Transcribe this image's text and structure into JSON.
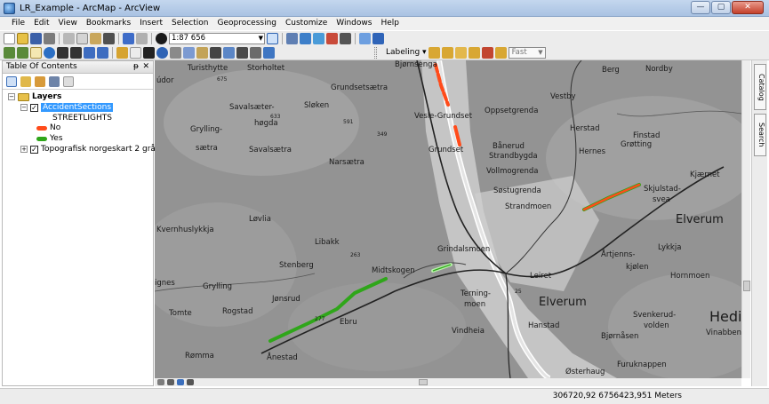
{
  "window": {
    "title": "LR_Example - ArcMap - ArcView",
    "min": "—",
    "max": "▢",
    "close": "✕"
  },
  "menu": [
    "File",
    "Edit",
    "View",
    "Bookmarks",
    "Insert",
    "Selection",
    "Geoprocessing",
    "Customize",
    "Windows",
    "Help"
  ],
  "toolbar": {
    "scale": "1:87 656",
    "labeling": "Labeling ▾",
    "quality": "Fast"
  },
  "toc": {
    "title": "Table Of Contents",
    "pin": "ᵽ",
    "close": "✕",
    "root": "Layers",
    "layer1": "AccidentSections",
    "field": "STREETLIGHTS",
    "legend": [
      {
        "label": "No",
        "color": "#ff4b1a"
      },
      {
        "label": "Yes",
        "color": "#2fa61a"
      }
    ],
    "layer2": "Topografisk norgeskart 2 gråtone",
    "expanded": "−",
    "collapsed": "+",
    "check": "✓"
  },
  "map": {
    "labels": {
      "turisthytte": "Turisthytte",
      "storholtet": "Storholtet",
      "udor": "údor",
      "bjornsenga": "Bjørnsenga",
      "berg": "Berg",
      "nordby": "Nordby",
      "grundsetsaetra": "Grundsetsætra",
      "vestby": "Vestby",
      "savalsaeter": "Savalsæter-",
      "hogda": "høgda",
      "sloken": "Sløken",
      "vesle_grundset": "Vesle-Grundset",
      "oppsetgrenda": "Oppsetgrenda",
      "herstad": "Herstad",
      "finstad": "Finstad",
      "grotting": "Grøtting",
      "grylling1": "Grylling-",
      "saetra": "sætra",
      "savalsaetra": "Savalsætra",
      "narsaetra": "Narsætra",
      "banerud": "Bånerud",
      "strandbygda": "Strandbygda",
      "hernes": "Hernes",
      "grundset": "Grundset",
      "vollmogrenda": "Vollmogrenda",
      "kjaernet": "Kjærnet",
      "skjulstad": "Skjulstad-",
      "svea": "svea",
      "sostugrenda": "Søstugrenda",
      "strandmoen": "Strandmoen",
      "elverum_big": "Elverum",
      "lovlia": "Løvlia",
      "kvernhuslykkja": "Kvernhuslykkja",
      "libakk": "Libakk",
      "lykkja": "Lykkja",
      "grindalsmoen": "Grindalsmoen",
      "artjenns": " Årtjenns-",
      "kjolen": "kjølen",
      "stenberg": "Stenberg",
      "midtskogen": "Midtskogen",
      "leiret": "Leiret",
      "hornmoen": "Hornmoen",
      "ignes": "ignes",
      "grylling2": "Grylling",
      "jonsrud": "Jønsrud",
      "terningmoen1": "Terning-",
      "terningmoen2": "moen",
      "elverum_center": "Elverum",
      "tomte": "Tomte",
      "rogstad": "Rogstad",
      "ebru": "Ebru",
      "svenkerud1": "Svenkerud-",
      "svenkerud2": "volden",
      "hed": "Hedi",
      "hanstad": "Hanstad",
      "vinabbeng": "Vinabbeng",
      "vindheia": "Vindheia",
      "bjornasen": "Bjørnåsen",
      "romma": "Rømma",
      "anestad": "Ånestad",
      "furuknappen": "Furuknappen",
      "osterhaug": "Østerhaug",
      "s675": "675",
      "s633": "633",
      "s591": "591",
      "s263": "263",
      "s277": "277",
      "s349": "349",
      "s25": "25"
    }
  },
  "status": {
    "coords": "306720,92  6756423,951 Meters"
  },
  "dock": {
    "catalog": "Catalog",
    "search": "Search"
  }
}
